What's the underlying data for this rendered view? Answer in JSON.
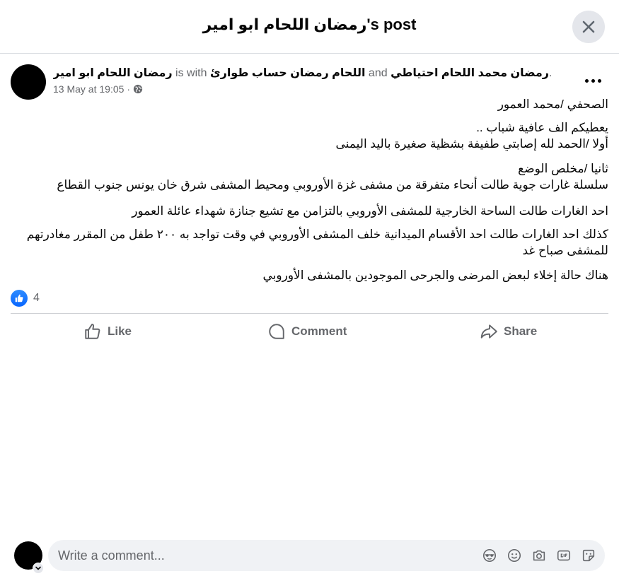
{
  "dialog": {
    "title": "رمضان اللحام ابو امير's post"
  },
  "post": {
    "author": "رمضان اللحام ابو امير",
    "is_with": "is with",
    "tagged_1": "اللحام رمضان حساب طوارئ",
    "and_text": "and",
    "tagged_2": "رمضان محمد اللحام احتياطي",
    "trailing": ".",
    "timestamp": "13 May at 19:05",
    "separator": "·",
    "audience_icon": "globe-icon",
    "text": {
      "line_1": "الصحفي /محمد العمور",
      "line_2": "يعطيكم الف عافية شباب ..",
      "line_3": "أولا /الحمد لله إصابتي طفيفة بشظية صغيرة باليد اليمنى",
      "line_4": "ثانيا /مخلص الوضع",
      "line_5": "سلسلة غارات جوية طالت أنحاء متفرقة من مشفى غزة الأوروبي ومحيط المشفى شرق خان يونس جنوب القطاع",
      "line_6": "احد الغارات طالت الساحة الخارجية للمشفى الأوروبي بالتزامن مع تشيع جنازة شهداء عائلة العمور",
      "line_7": "كذلك احد الغارات طالت احد الأقسام الميدانية خلف المشفى الأوروبي في وقت تواجد به ٢٠٠ طفل من المقرر مغادرتهم للمشفى صباح غد",
      "line_8": "هناك حالة إخلاء لبعض المرضى والجرحى الموجودين بالمشفى الأوروبي"
    },
    "reaction_count": "4"
  },
  "actions": {
    "like": "Like",
    "comment": "Comment",
    "share": "Share"
  },
  "composer": {
    "placeholder": "Write a comment...",
    "icons": [
      "avatar-sticker-icon",
      "emoji-icon",
      "camera-icon",
      "gif-icon",
      "sticker-icon"
    ]
  },
  "colors": {
    "accent": "#0866ff",
    "secondary_text": "#65676b",
    "surface": "#f0f2f5"
  }
}
